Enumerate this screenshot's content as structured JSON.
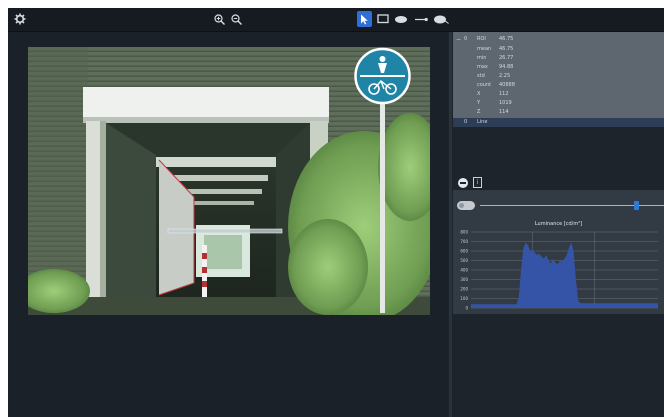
{
  "toolbar": {
    "icons": [
      "gear-icon",
      "zoom-in-icon",
      "zoom-out-icon",
      "pointer-icon",
      "rectangle-icon",
      "ellipse-icon",
      "line-icon",
      "polygon-icon"
    ],
    "active_tool": "pointer-icon",
    "accent": "#2f6fd6"
  },
  "stats": {
    "roi_index": "0",
    "roi_name": "ROI",
    "roi_value": "46.75",
    "rows": [
      {
        "key": "mean",
        "value": "46.75"
      },
      {
        "key": "min",
        "value": "26.77"
      },
      {
        "key": "max",
        "value": "94.88"
      },
      {
        "key": "std",
        "value": "2.25"
      },
      {
        "key": "count",
        "value": "40888"
      },
      {
        "key": "X",
        "value": "112"
      },
      {
        "key": "Y",
        "value": "1019"
      },
      {
        "key": "Z",
        "value": "114"
      }
    ],
    "selected_index": "0",
    "selected_name": "Line"
  },
  "histogram": {
    "slider_position": 0.85,
    "toggle_on": false
  },
  "chart_data": {
    "type": "area",
    "title": "Luminance [cd/m²]",
    "ylim": [
      0,
      800
    ],
    "yticks": [
      "800",
      "700",
      "600",
      "500",
      "400",
      "300",
      "200",
      "100",
      "0"
    ],
    "x": [
      0,
      4,
      8,
      12,
      16,
      20,
      24,
      28,
      32,
      36,
      40,
      42,
      44,
      46,
      48,
      50,
      52,
      54,
      56,
      58,
      60,
      62,
      64,
      66,
      68,
      70,
      72,
      74,
      76,
      78,
      80,
      82,
      84,
      86,
      88,
      90,
      92,
      94,
      96,
      98,
      100,
      104,
      108,
      112,
      116,
      120,
      124,
      128,
      132,
      136,
      140,
      144,
      148,
      152,
      156,
      160,
      164
    ],
    "values": [
      40,
      40,
      40,
      40,
      40,
      40,
      40,
      40,
      40,
      40,
      40,
      120,
      420,
      640,
      690,
      660,
      600,
      620,
      580,
      560,
      570,
      540,
      520,
      560,
      500,
      470,
      520,
      480,
      460,
      500,
      490,
      520,
      560,
      640,
      690,
      600,
      300,
      80,
      50,
      50,
      50,
      50,
      50,
      50,
      50,
      50,
      50,
      50,
      50,
      50,
      50,
      50,
      50,
      50,
      50,
      50,
      50
    ],
    "colors": {
      "fill": "#3554a8",
      "grid": "#8c939a"
    },
    "grid": true
  }
}
